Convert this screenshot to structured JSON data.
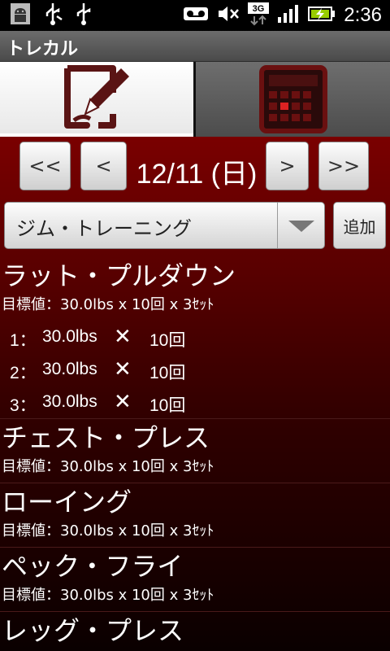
{
  "status_bar": {
    "time": "2:36",
    "network": "3G",
    "left_icons": [
      "android-icon",
      "usb-icon",
      "usb-icon"
    ],
    "right_icons": [
      "voicemail-icon",
      "mute-icon",
      "3g-icon",
      "signal-icon",
      "battery-charging-icon"
    ]
  },
  "app": {
    "title": "トレカル"
  },
  "tabs": [
    {
      "name": "input",
      "icon": "edit-icon",
      "selected": true
    },
    {
      "name": "calendar",
      "icon": "calendar-icon",
      "selected": false
    }
  ],
  "date_nav": {
    "prev_week": "<<",
    "prev_day": "<",
    "date": "12/11 (日)",
    "next_day": ">",
    "next_week": ">>"
  },
  "category": {
    "selected": "ジム・トレーニング",
    "add_label": "追加"
  },
  "exercises": [
    {
      "name": "ラット・プルダウン",
      "target": "目標値：30.0lbs x 10回 x 3ｾｯﾄ",
      "sets": [
        {
          "no": "1：",
          "weight": "30.0lbs",
          "x": "✕",
          "reps": "10回"
        },
        {
          "no": "2：",
          "weight": "30.0lbs",
          "x": "✕",
          "reps": "10回"
        },
        {
          "no": "3：",
          "weight": "30.0lbs",
          "x": "✕",
          "reps": "10回"
        }
      ]
    },
    {
      "name": "チェスト・プレス",
      "target": "目標値：30.0lbs x 10回 x 3ｾｯﾄ"
    },
    {
      "name": "ローイング",
      "target": "目標値：30.0lbs x 10回 x 3ｾｯﾄ"
    },
    {
      "name": "ペック・フライ",
      "target": "目標値：30.0lbs x 10回 x 3ｾｯﾄ"
    },
    {
      "name": "レッグ・プレス"
    }
  ],
  "colors": {
    "accent": "#7a0000",
    "icon": "#6a1010",
    "title_bar": "#5a5a5a"
  }
}
